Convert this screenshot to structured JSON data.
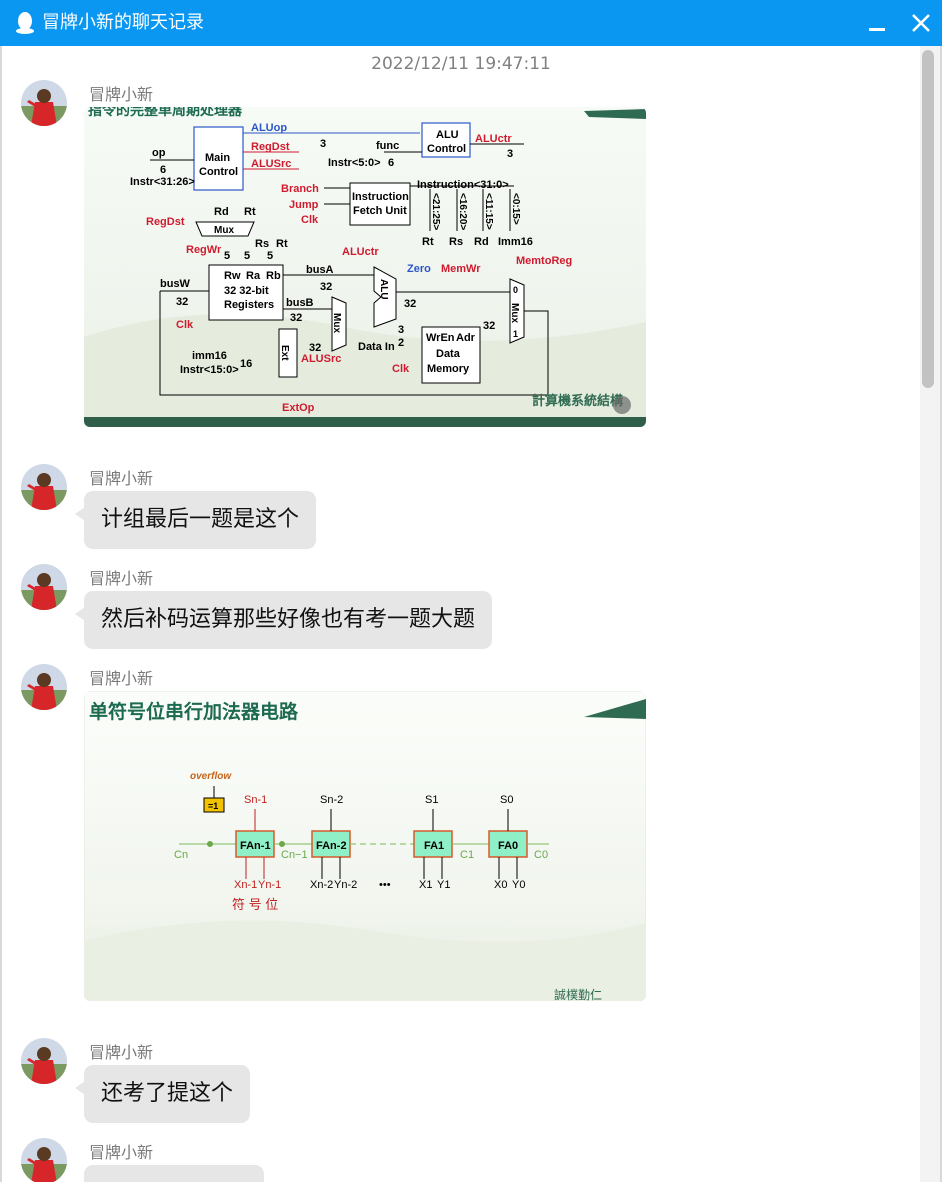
{
  "window": {
    "title": "冒牌小新的聊天记录",
    "icon": "qq-penguin-icon",
    "colors": {
      "titlebar": "#0a97f2",
      "bubble": "#e6e6e6"
    }
  },
  "chat": {
    "timestamp": "2022/12/11 19:47:11",
    "messages": [
      {
        "sender": "冒牌小新",
        "type": "image",
        "image": {
          "title": "指令的完整单周期处理器",
          "labels": {
            "aluop": "ALUop",
            "regdst": "RegDst",
            "alusrc": "ALUSrc",
            "op": "op",
            "op_bits": "6",
            "instr_op": "Instr<31:26>",
            "main_control_1": "Main",
            "main_control_2": "Control",
            "three": "3",
            "func": "func",
            "instr_func": "Instr<5:0>",
            "six": "6",
            "alu_control_1": "ALU",
            "alu_control_2": "Control",
            "aluctr": "ALUctr",
            "branch": "Branch",
            "jump": "Jump",
            "clk": "Clk",
            "ifu_1": "Instruction",
            "ifu_2": "Fetch Unit",
            "instruction": "Instruction<31:0>",
            "f1": "<21:25>",
            "f2": "<16:20>",
            "f3": "<11:15>",
            "f4": "<0:15>",
            "rt": "Rt",
            "rs": "Rs",
            "rd": "Rd",
            "imm16": "Imm16",
            "regdst2": "RegDst",
            "mux": "Mux",
            "regwr": "RegWr",
            "five": "5",
            "rw": "Rw",
            "ra": "Ra",
            "rb": "Rb",
            "regs_1": "32 32-bit",
            "regs_2": "Registers",
            "busw": "busW",
            "thirtytwo": "32",
            "busa": "busA",
            "busb": "busB",
            "aluctr2": "ALUctr",
            "zero": "Zero",
            "memwr": "MemWr",
            "memtoreg": "MemtoReg",
            "alu": "ALU",
            "wren": "WrEn",
            "adr": "Adr",
            "data_mem_1": "Data",
            "data_mem_2": "Memory",
            "data_in": "Data In",
            "imm16_in": "imm16",
            "instr_imm": "Instr<15:0>",
            "sixteen": "16",
            "ext": "Ext",
            "extop": "ExtOp",
            "alusrc2": "ALUSrc",
            "two": "2",
            "one": "1",
            "zero_digit": "0",
            "footer_text": "計算機系統結構"
          }
        }
      },
      {
        "sender": "冒牌小新",
        "type": "text",
        "text": "计组最后一题是这个"
      },
      {
        "sender": "冒牌小新",
        "type": "text",
        "text": "然后补码运算那些好像也有考一题大题"
      },
      {
        "sender": "冒牌小新",
        "type": "image",
        "image": {
          "title": "单符号位串行加法器电路",
          "labels": {
            "overflow": "overflow",
            "xor": "=1",
            "cn": "Cn",
            "sn1": "Sn-1",
            "sn2": "Sn-2",
            "s1": "S1",
            "s0": "S0",
            "fan1": "FAn-1",
            "fan2": "FAn-2",
            "fa1": "FA1",
            "fa0": "FA0",
            "cn1": "Cn−1",
            "c1": "C1",
            "c0": "C0",
            "xn1": "Xn-1",
            "yn1": "Yn-1",
            "xn2": "Xn-2",
            "yn2": "Yn-2",
            "dots": "•••",
            "x1": "X1",
            "y1": "Y1",
            "x0": "X0",
            "y0": "Y0",
            "sign": "符 号 位",
            "footer_text": "誠樸勤仁"
          }
        }
      },
      {
        "sender": "冒牌小新",
        "type": "text",
        "text": "还考了提这个"
      },
      {
        "sender": "冒牌小新",
        "type": "text",
        "text": ""
      }
    ]
  }
}
